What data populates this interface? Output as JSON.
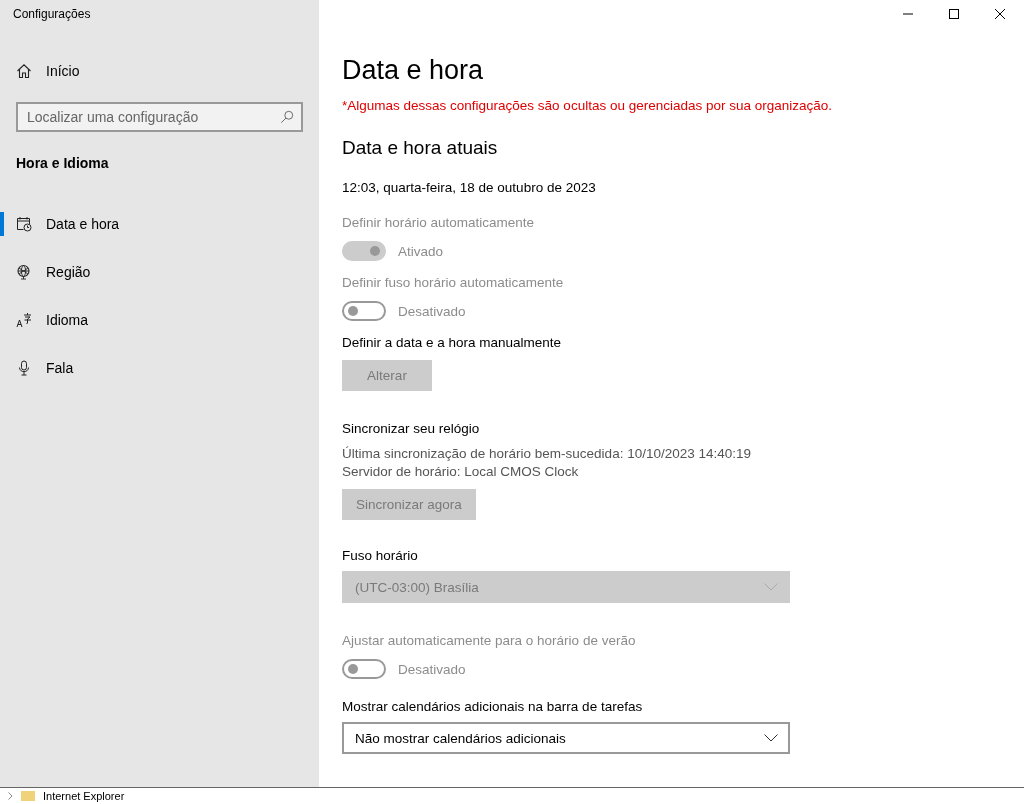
{
  "window": {
    "title": "Configurações"
  },
  "sidebar": {
    "home": "Início",
    "search": {
      "placeholder": "Localizar uma configuração"
    },
    "section": "Hora e Idioma",
    "items": [
      {
        "label": "Data e hora",
        "kind": "calendar",
        "selected": true
      },
      {
        "label": "Região",
        "kind": "globe",
        "selected": false
      },
      {
        "label": "Idioma",
        "kind": "language",
        "selected": false
      },
      {
        "label": "Fala",
        "kind": "microphone",
        "selected": false
      }
    ]
  },
  "page": {
    "title": "Data e hora",
    "notice": "*Algumas dessas configurações são ocultas ou gerenciadas por sua organização.",
    "heading": "Data e hora atuais",
    "current": "12:03, quarta-feira, 18 de outubro de 2023",
    "settings": [
      {
        "kind": "toggle",
        "label": "Definir horário automaticamente",
        "on": true,
        "disabled": true,
        "state": "Ativado"
      },
      {
        "kind": "toggle",
        "label": "Definir fuso horário automaticamente",
        "on": false,
        "disabled": true,
        "state": "Desativado"
      },
      {
        "kind": "button",
        "label": "Definir a data e a hora manualmente",
        "button": "Alterar",
        "disabled": true
      },
      {
        "kind": "button",
        "label": "Sincronizar seu relógio",
        "lines": [
          "Última sincronização de horário bem-sucedida: 10/10/2023 14:40:19",
          "Servidor de horário: Local CMOS Clock"
        ],
        "button": "Sincronizar agora",
        "disabled": true
      },
      {
        "kind": "dropdown",
        "label": "Fuso horário",
        "value": "(UTC-03:00) Brasília",
        "disabled": true
      },
      {
        "kind": "toggle",
        "label": "Ajustar automaticamente para o horário de verão",
        "on": false,
        "disabled": true,
        "state": "Desativado"
      },
      {
        "kind": "dropdown",
        "label": "Mostrar calendários adicionais na barra de tarefas",
        "value": "Não mostrar calendários adicionais",
        "disabled": false
      }
    ]
  },
  "background_window": {
    "tree_item": "Internet Explorer"
  }
}
